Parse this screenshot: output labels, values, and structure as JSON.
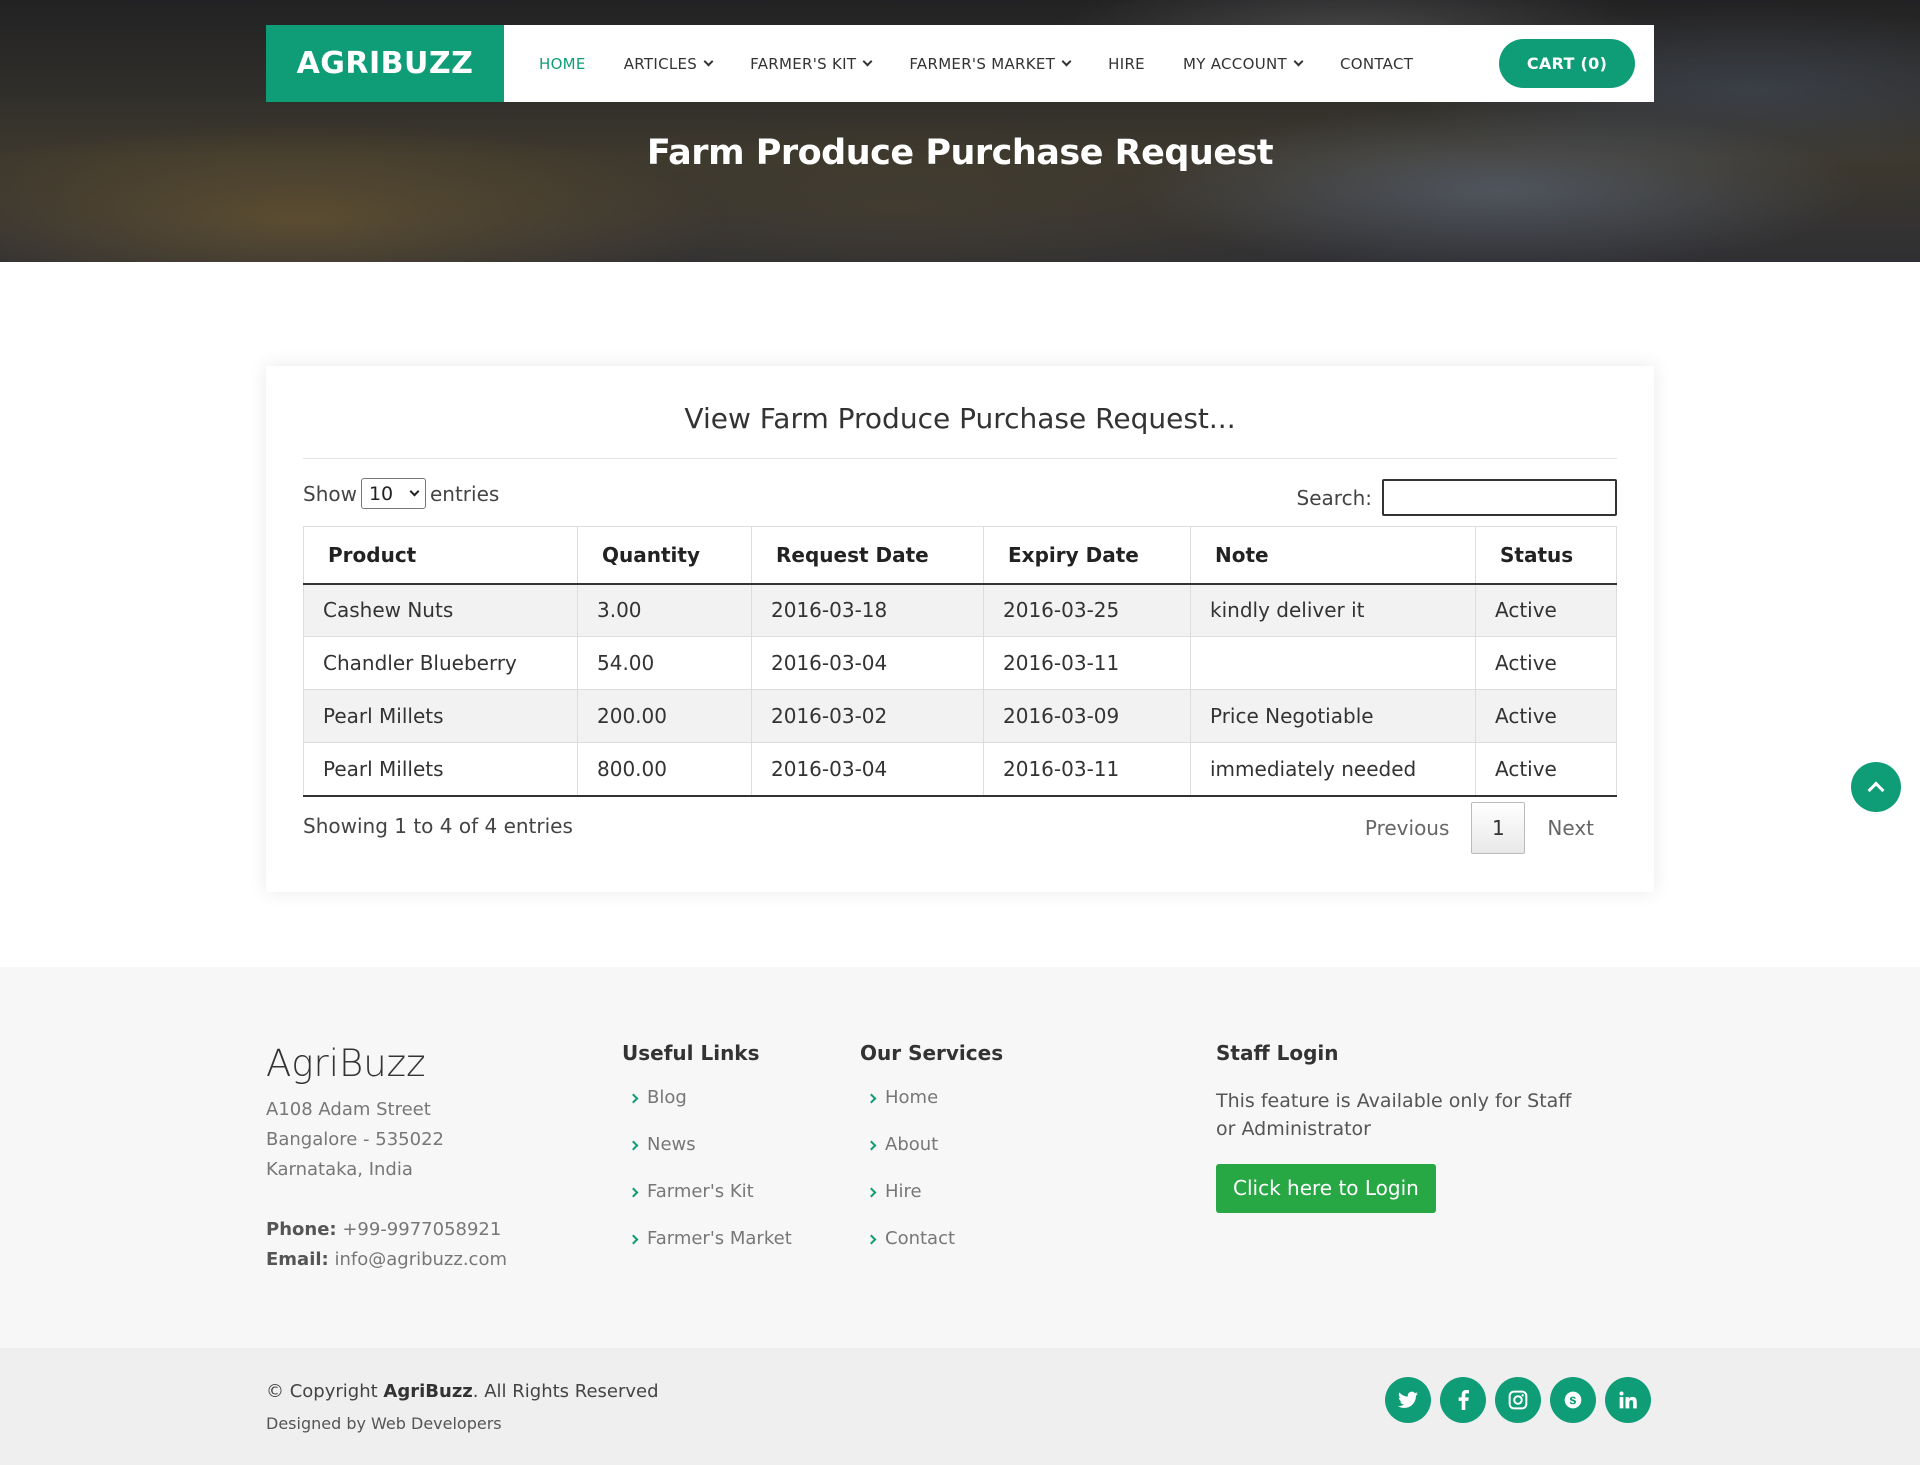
{
  "brand": {
    "logo": "AGRIBUZZ",
    "accent_color": "#0f9d77"
  },
  "nav": {
    "items": [
      {
        "label": "HOME",
        "active": true
      },
      {
        "label": "ARTICLES",
        "dropdown": true
      },
      {
        "label": "FARMER'S KIT",
        "dropdown": true
      },
      {
        "label": "FARMER'S MARKET",
        "dropdown": true
      },
      {
        "label": "HIRE"
      },
      {
        "label": "MY ACCOUNT",
        "dropdown": true
      },
      {
        "label": "CONTACT"
      }
    ],
    "cart_label": "CART (0)"
  },
  "hero": {
    "title": "Farm Produce Purchase Request"
  },
  "panel": {
    "title": "View Farm Produce Purchase Request...",
    "show_label": "Show",
    "entries_value": "10",
    "entries_label": "entries",
    "search_label": "Search:",
    "search_value": ""
  },
  "table": {
    "columns": [
      "Product",
      "Quantity",
      "Request Date",
      "Expiry Date",
      "Note",
      "Status"
    ],
    "rows": [
      [
        "Cashew Nuts",
        "3.00",
        "2016-03-18",
        "2016-03-25",
        "kindly deliver it",
        "Active"
      ],
      [
        "Chandler Blueberry",
        "54.00",
        "2016-03-04",
        "2016-03-11",
        "",
        "Active"
      ],
      [
        "Pearl Millets",
        "200.00",
        "2016-03-02",
        "2016-03-09",
        "Price Negotiable",
        "Active"
      ],
      [
        "Pearl Millets",
        "800.00",
        "2016-03-04",
        "2016-03-11",
        "immediately needed",
        "Active"
      ]
    ],
    "info": "Showing 1 to 4 of 4 entries",
    "pagination": {
      "previous": "Previous",
      "current": "1",
      "next": "Next"
    }
  },
  "footer": {
    "brand": "AgriBuzz",
    "address": [
      "A108 Adam Street",
      "Bangalore - 535022",
      "Karnataka, India"
    ],
    "phone_label": "Phone:",
    "phone": "+99-9977058921",
    "email_label": "Email:",
    "email": "info@agribuzz.com",
    "useful_links": {
      "title": "Useful Links",
      "items": [
        "Blog",
        "News",
        "Farmer's Kit",
        "Farmer's Market"
      ]
    },
    "services": {
      "title": "Our Services",
      "items": [
        "Home",
        "About",
        "Hire",
        "Contact"
      ]
    },
    "staff": {
      "title": "Staff Login",
      "text": "This feature is Available only for Staff or Administrator",
      "button": "Click here to Login"
    },
    "copyright_prefix": "© Copyright",
    "copyright_brand": "AgriBuzz",
    "copyright_suffix": ". All Rights Reserved",
    "designed_by": "Designed by Web Developers",
    "socials": [
      "twitter-icon",
      "facebook-icon",
      "instagram-icon",
      "skype-icon",
      "linkedin-icon"
    ]
  }
}
